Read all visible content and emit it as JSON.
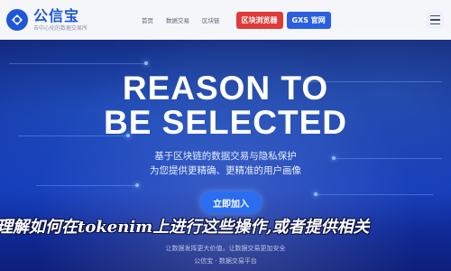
{
  "header": {
    "logo_name": "公信宝",
    "logo_slogan": "去中心化的数据交易所",
    "nav": [
      "首页",
      "数据交易",
      "区块链"
    ],
    "buttons": [
      "区块浏览器",
      "GXS 官网"
    ]
  },
  "hero": {
    "title_line1": "REASON TO",
    "title_line2": "BE SELECTED",
    "subtitle_line1": "基于区块链的数据交易与隐私保护",
    "subtitle_line2": "为您提供更精确、更精准的用户画像",
    "cta_label": "立即加入"
  },
  "overlay_title": "理解如何在tokenim上进行这些操作,或者提供相关",
  "footer": {
    "line1": "让数据发挥更大价值，让数据交易更加安全",
    "line2": "公信宝 · 数据交易平台"
  },
  "colors": {
    "brand": "#1e57d8",
    "red_button": "#e03a3a",
    "blue_button": "#2b5fe0",
    "cta": "#2a6df0"
  },
  "icons": [
    "logo-mark-icon",
    "menu-icon"
  ]
}
